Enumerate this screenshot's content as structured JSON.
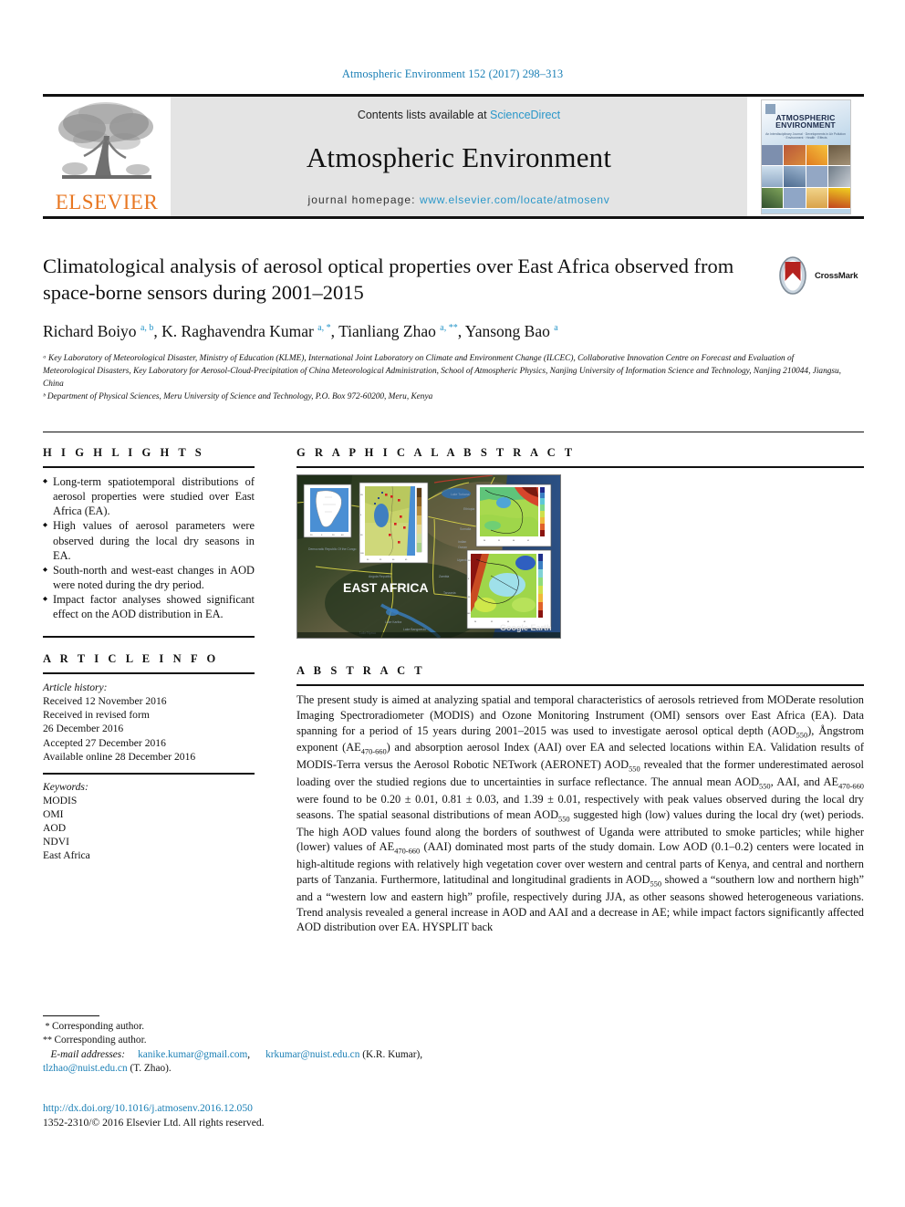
{
  "running_head": "Atmospheric Environment 152 (2017) 298–313",
  "masthead": {
    "elsevier_wordmark": "ELSEVIER",
    "contents_prefix": "Contents lists available at ",
    "contents_link": "ScienceDirect",
    "journal_name": "Atmospheric Environment",
    "homepage_prefix": "journal homepage: ",
    "homepage_url": "www.elsevier.com/locate/atmosenv",
    "cover": {
      "title_line1": "ATMOSPHERIC",
      "title_line2": "ENVIRONMENT",
      "subtitle": "An Interdisciplinary Journal · Developments in Air Pollution · Environment · Health · Effects"
    }
  },
  "article": {
    "title": "Climatological analysis of aerosol optical properties over East Africa observed from space-borne sensors during 2001–2015",
    "crossmark_label": "CrossMark",
    "authors_html": "Richard Boiyo <sup>a, b</sup>, K. Raghavendra Kumar <sup>a, *</sup>, Tianliang Zhao <sup>a, **</sup>, Yansong Bao <sup>a</sup>",
    "affiliations": [
      "ᵃ Key Laboratory of Meteorological Disaster, Ministry of Education (KLME), International Joint Laboratory on Climate and Environment Change (ILCEC), Collaborative Innovation Centre on Forecast and Evaluation of Meteorological Disasters, Key Laboratory for Aerosol-Cloud-Precipitation of China Meteorological Administration, School of Atmospheric Physics, Nanjing University of Information Science and Technology, Nanjing 210044, Jiangsu, China",
      "ᵇ Department of Physical Sciences, Meru University of Science and Technology, P.O. Box 972-60200, Meru, Kenya"
    ]
  },
  "highlights": {
    "heading": "H I G H L I G H T S",
    "items": [
      "Long-term spatiotemporal distributions of aerosol properties were studied over East Africa (EA).",
      "High values of aerosol parameters were observed during the local dry seasons in EA.",
      "South-north and west-east changes in AOD were noted during the dry period.",
      "Impact factor analyses showed significant effect on the AOD distribution in EA."
    ]
  },
  "article_info": {
    "heading": "A R T I C L E   I N F O",
    "history_label": "Article history:",
    "history": [
      "Received 12 November 2016",
      "Received in revised form",
      "26 December 2016",
      "Accepted 27 December 2016",
      "Available online 28 December 2016"
    ],
    "keywords_label": "Keywords:",
    "keywords": [
      "MODIS",
      "OMI",
      "AOD",
      "NDVI",
      "East Africa"
    ]
  },
  "graphical_abstract": {
    "heading": "G R A P H I C A L   A B S T R A C T",
    "map_label": "EAST AFRICA",
    "attribution": "Google Earth"
  },
  "abstract": {
    "heading": "A B S T R A C T",
    "paragraph": "The present study is aimed at analyzing spatial and temporal characteristics of aerosols retrieved from MODerate resolution Imaging Spectroradiometer (MODIS) and Ozone Monitoring Instrument (OMI) sensors over East Africa (EA). Data spanning for a period of 15 years during 2001–2015 was used to investigate aerosol optical depth (AOD550), Ångstrom exponent (AE470-660) and absorption aerosol Index (AAI) over EA and selected locations within EA. Validation results of MODIS-Terra versus the Aerosol Robotic NETwork (AERONET) AOD550 revealed that the former underestimated aerosol loading over the studied regions due to uncertainties in surface reflectance. The annual mean AOD550, AAI, and AE470-660 were found to be 0.20 ± 0.01, 0.81 ± 0.03, and 1.39 ± 0.01, respectively with peak values observed during the local dry seasons. The spatial seasonal distributions of mean AOD550 suggested high (low) values during the local dry (wet) periods. The high AOD values found along the borders of southwest of Uganda were attributed to smoke particles; while higher (lower) values of AE470-660 (AAI) dominated most parts of the study domain. Low AOD (0.1–0.2) centers were located in high-altitude regions with relatively high vegetation cover over western and central parts of Kenya, and central and northern parts of Tanzania. Furthermore, latitudinal and longitudinal gradients in AOD550 showed a “southern low and northern high” and a “western low and eastern high” profile, respectively during JJA, as other seasons showed heterogeneous variations. Trend analysis revealed a general increase in AOD and AAI and a decrease in AE; while impact factors significantly affected AOD distribution over EA. HYSPLIT back"
  },
  "footnotes": {
    "corresponding_1": "Corresponding author.",
    "corresponding_2": "Corresponding author.",
    "email_label": "E-mail addresses:",
    "email_1": "kanike.kumar@gmail.com",
    "email_2": "krkumar@nuist.edu.cn",
    "email_1_owner": "(K.R. Kumar),",
    "email_3": "tlzhao@nuist.edu.cn",
    "email_3_owner": "(T. Zhao)."
  },
  "doi": {
    "url": "http://dx.doi.org/10.1016/j.atmosenv.2016.12.050",
    "copyright": "1352-2310/© 2016 Elsevier Ltd. All rights reserved."
  },
  "colors": {
    "link_blue": "#1a7fb5",
    "sciencedirect_blue": "#2a97c9",
    "elsevier_orange": "#E87722",
    "masthead_grey": "#e4e4e4"
  }
}
